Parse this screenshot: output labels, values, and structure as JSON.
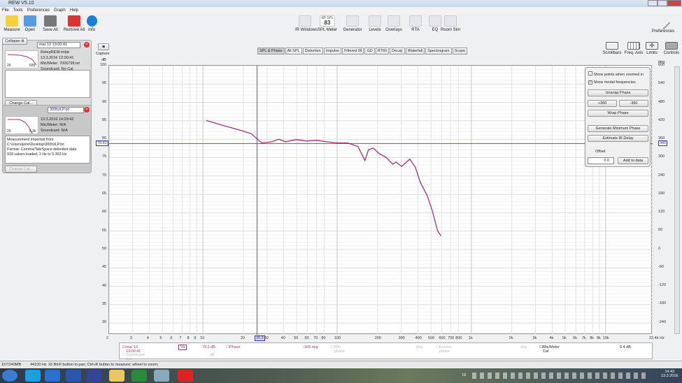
{
  "window": {
    "title": "REW V5.10"
  },
  "menu": [
    "File",
    "Tools",
    "Preferences",
    "Graph",
    "Help"
  ],
  "toolbar": [
    {
      "label": "Measure",
      "icon": "measure-icon",
      "color": "#f4d23a"
    },
    {
      "label": "Open",
      "icon": "folder-icon",
      "color": "#5a9be0"
    },
    {
      "label": "Save All",
      "icon": "save-icon",
      "color": "#777"
    },
    {
      "label": "Remove All",
      "icon": "remove-icon",
      "color": "#d33"
    },
    {
      "label": "Info",
      "icon": "info-icon",
      "color": "#1a7ee0"
    }
  ],
  "center_tools": [
    {
      "label": "IR Windows",
      "color": "#c44"
    },
    {
      "label": "SPL Meter",
      "color": "#333",
      "value": "83",
      "top": "dB SPL"
    },
    {
      "label": "Generator",
      "color": "#47c"
    },
    {
      "label": "Levels",
      "color": "#2a2"
    },
    {
      "label": "Overlays",
      "color": "#777"
    },
    {
      "label": "RTA",
      "color": "#339"
    },
    {
      "label": "EQ",
      "color": "#16c"
    },
    {
      "label": "Room Sim",
      "color": "#a44"
    }
  ],
  "right_tools": {
    "preferences": "Preferences",
    "scrollbars": "Scrollbars",
    "freq_axis": "Freq. Axis",
    "limits": "Limits",
    "controls": "Controls"
  },
  "capture": "Capture",
  "collapse": "Collapse",
  "measurements": [
    {
      "name": "mar 13 13:00:41",
      "file": "RetepREW.mdat",
      "date": "13.3.2016 12:00:41",
      "mic": "Mic/Meter: 7000799.txt",
      "soundcard": "Soundcard: No Cal",
      "thumb_min": "20",
      "thumb_max": "600",
      "notes": "",
      "change_cal": "Change Cal..."
    },
    {
      "name": "300hzLP.txt",
      "file": "",
      "date": "13.3.2016 14:29:42",
      "mic": "Mic/Meter: N/A",
      "soundcard": "Soundcard: N/A",
      "thumb_min": "20",
      "thumb_max": "5.3k",
      "notes": "Measurement imported from\nC:\\Users\\joho\\Desktop\\300hzLP.txt\nFormat: Comma/Tab/Space delimited data\n918 values loaded, 2 Hz to 5.303 Hz",
      "change_cal": "Change Cal..."
    }
  ],
  "tabs": [
    "SPL & Phase",
    "All SPL",
    "Distortion",
    "Impulse",
    "Filtered IR",
    "GD",
    "RT60",
    "Decay",
    "Waterfall",
    "Spectrogram",
    "Scope"
  ],
  "controls": {
    "show_points": "Show points when zoomed in",
    "show_points_checked": false,
    "show_modal": "Show modal frequencies",
    "show_modal_checked": true,
    "unwrap": "Unwrap Phase",
    "plus360": "+360",
    "minus360": "-360",
    "wrap": "Wrap Phase",
    "gen_min_phase": "Generate Minimum Phase",
    "estimate_ir": "Estimate IR Delay",
    "offset_label": "Offset",
    "offset_value": "0.0",
    "add_to_data": "Add to data"
  },
  "cursor": {
    "db": "78.82",
    "deg": "346",
    "freq": "25.3"
  },
  "legend": {
    "name": "mar 13 13:00:41",
    "spl": "79.2 dB",
    "phase_label": "Phase",
    "phase": "-165 deg",
    "min_phase": "Min phase",
    "deg1": "deg",
    "excess": "Excess phase",
    "deg2": "deg",
    "mic_cal": "Mic/Meter Cal",
    "mic_val": "0.4 dB",
    "soundcard_cal": "Soundcard Cal",
    "sc_val": "dB",
    "color": "#a0307a"
  },
  "status": {
    "memory": "157/240MB",
    "rate": "44100 Hz",
    "bits": "16 Bit",
    "hint": "R button to pan; Ctrl+R button to measure; wheel to zoom;"
  },
  "tray": {
    "time": "14:43",
    "date": "13.3.2016",
    "lang": "IS"
  },
  "chart_data": {
    "type": "line",
    "title": "SPL & Phase",
    "ylabel": "dB",
    "y2label": "deg",
    "xlabel": "Hz",
    "xscale": "log",
    "xlim": [
      2,
      22400
    ],
    "ylim": [
      26.8,
      100
    ],
    "y2lim": [
      -280,
      600
    ],
    "yticks": [
      100,
      95,
      90,
      85,
      80,
      75,
      70,
      65,
      60,
      55,
      50,
      45,
      40,
      35,
      30
    ],
    "y2ticks": [
      600,
      540,
      480,
      420,
      360,
      300,
      240,
      180,
      120,
      60,
      0,
      -60,
      -120,
      -180,
      -240
    ],
    "xticks": [
      {
        "v": 2,
        "l": "2"
      },
      {
        "v": 3,
        "l": "3"
      },
      {
        "v": 4,
        "l": "4"
      },
      {
        "v": 5,
        "l": "5"
      },
      {
        "v": 6,
        "l": "6"
      },
      {
        "v": 7,
        "l": "7"
      },
      {
        "v": 8,
        "l": "8"
      },
      {
        "v": 9,
        "l": "9"
      },
      {
        "v": 10,
        "l": "10"
      },
      {
        "v": 20,
        "l": "20"
      },
      {
        "v": 30,
        "l": "30"
      },
      {
        "v": 40,
        "l": "40"
      },
      {
        "v": 50,
        "l": "50"
      },
      {
        "v": 60,
        "l": "60"
      },
      {
        "v": 70,
        "l": "70"
      },
      {
        "v": 80,
        "l": "80"
      },
      {
        "v": 100,
        "l": "100"
      },
      {
        "v": 200,
        "l": "200"
      },
      {
        "v": 300,
        "l": "300"
      },
      {
        "v": 400,
        "l": "400"
      },
      {
        "v": 500,
        "l": "500"
      },
      {
        "v": 600,
        "l": "600"
      },
      {
        "v": 700,
        "l": "700"
      },
      {
        "v": 800,
        "l": "800"
      },
      {
        "v": 1000,
        "l": "1k"
      },
      {
        "v": 2000,
        "l": "2k"
      },
      {
        "v": 3000,
        "l": "3k"
      },
      {
        "v": 4000,
        "l": "4k"
      },
      {
        "v": 5000,
        "l": "5k"
      },
      {
        "v": 6000,
        "l": "6k"
      },
      {
        "v": 7000,
        "l": "7k"
      },
      {
        "v": 8000,
        "l": "8k"
      },
      {
        "v": 9000,
        "l": "9k"
      },
      {
        "v": 10000,
        "l": "10k"
      },
      {
        "v": 22400,
        "l": "22,4k Hz"
      }
    ],
    "series": [
      {
        "name": "mar 13 13:00:41 SPL",
        "color": "#a0307a",
        "x": [
          10.6,
          14.3,
          19.2,
          22.9,
          27.4,
          32.7,
          36.8,
          41.4,
          49.5,
          59,
          70.5,
          84.2,
          100,
          120,
          143,
          161,
          171,
          186,
          205,
          231,
          260,
          275,
          302,
          348,
          383,
          415,
          469,
          509,
          560,
          593
        ],
        "y": [
          85.1,
          83.7,
          82.4,
          81.5,
          79.0,
          79.3,
          80.0,
          79.3,
          79.9,
          79.5,
          79.7,
          79.3,
          79.0,
          79.0,
          78.0,
          74.2,
          77.1,
          77.6,
          76.1,
          75.1,
          73.2,
          73.8,
          72.6,
          74.6,
          72.3,
          68.4,
          64.6,
          60.8,
          55.1,
          53.7
        ]
      }
    ]
  }
}
